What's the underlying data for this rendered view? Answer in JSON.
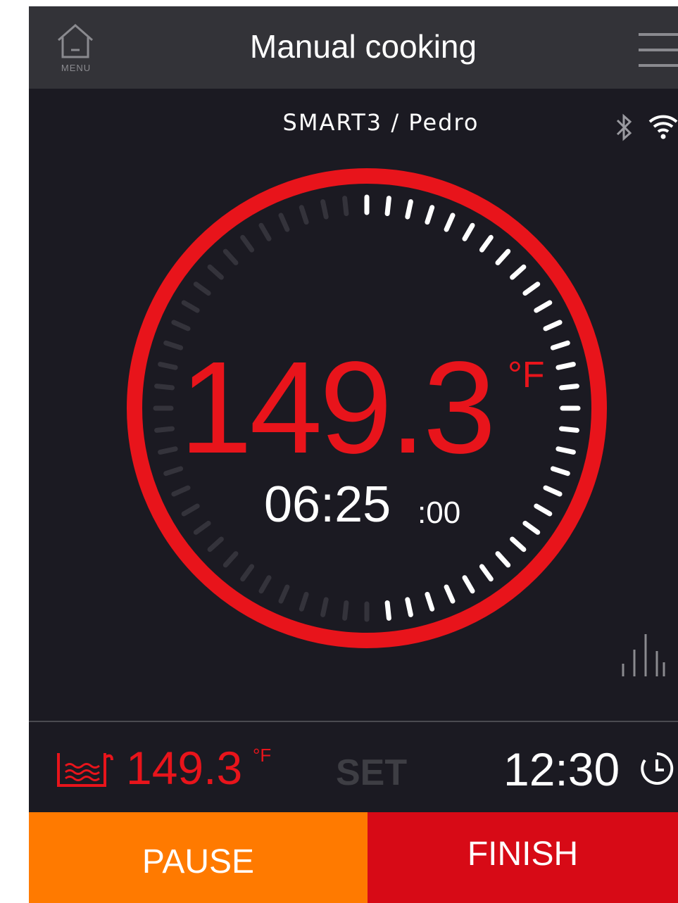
{
  "header": {
    "menu_label": "MENU",
    "title": "Manual cooking",
    "home_icon": "home-icon",
    "hamburger_icon": "hamburger-menu-icon"
  },
  "status": {
    "device": "SMART3 / Pedro",
    "bluetooth_icon": "bluetooth-icon",
    "wifi_icon": "wifi-icon"
  },
  "dial": {
    "temperature": "149.3",
    "unit": "°F",
    "time_main": "06:25",
    "time_seconds": ":00",
    "progress": 0.5
  },
  "bottom": {
    "bath_icon": "water-bath-icon",
    "bath_temperature": "149.3",
    "bath_unit": "°F",
    "set_label": "SET",
    "timer": "12:30",
    "timer_icon": "timer-icon"
  },
  "actions": {
    "pause": "PAUSE",
    "finish": "FINISH"
  },
  "colors": {
    "accent_red": "#e8141b",
    "pause_orange": "#ff7a00",
    "finish_red": "#d70a16",
    "background": "#1b1a22",
    "topbar": "#333338"
  }
}
